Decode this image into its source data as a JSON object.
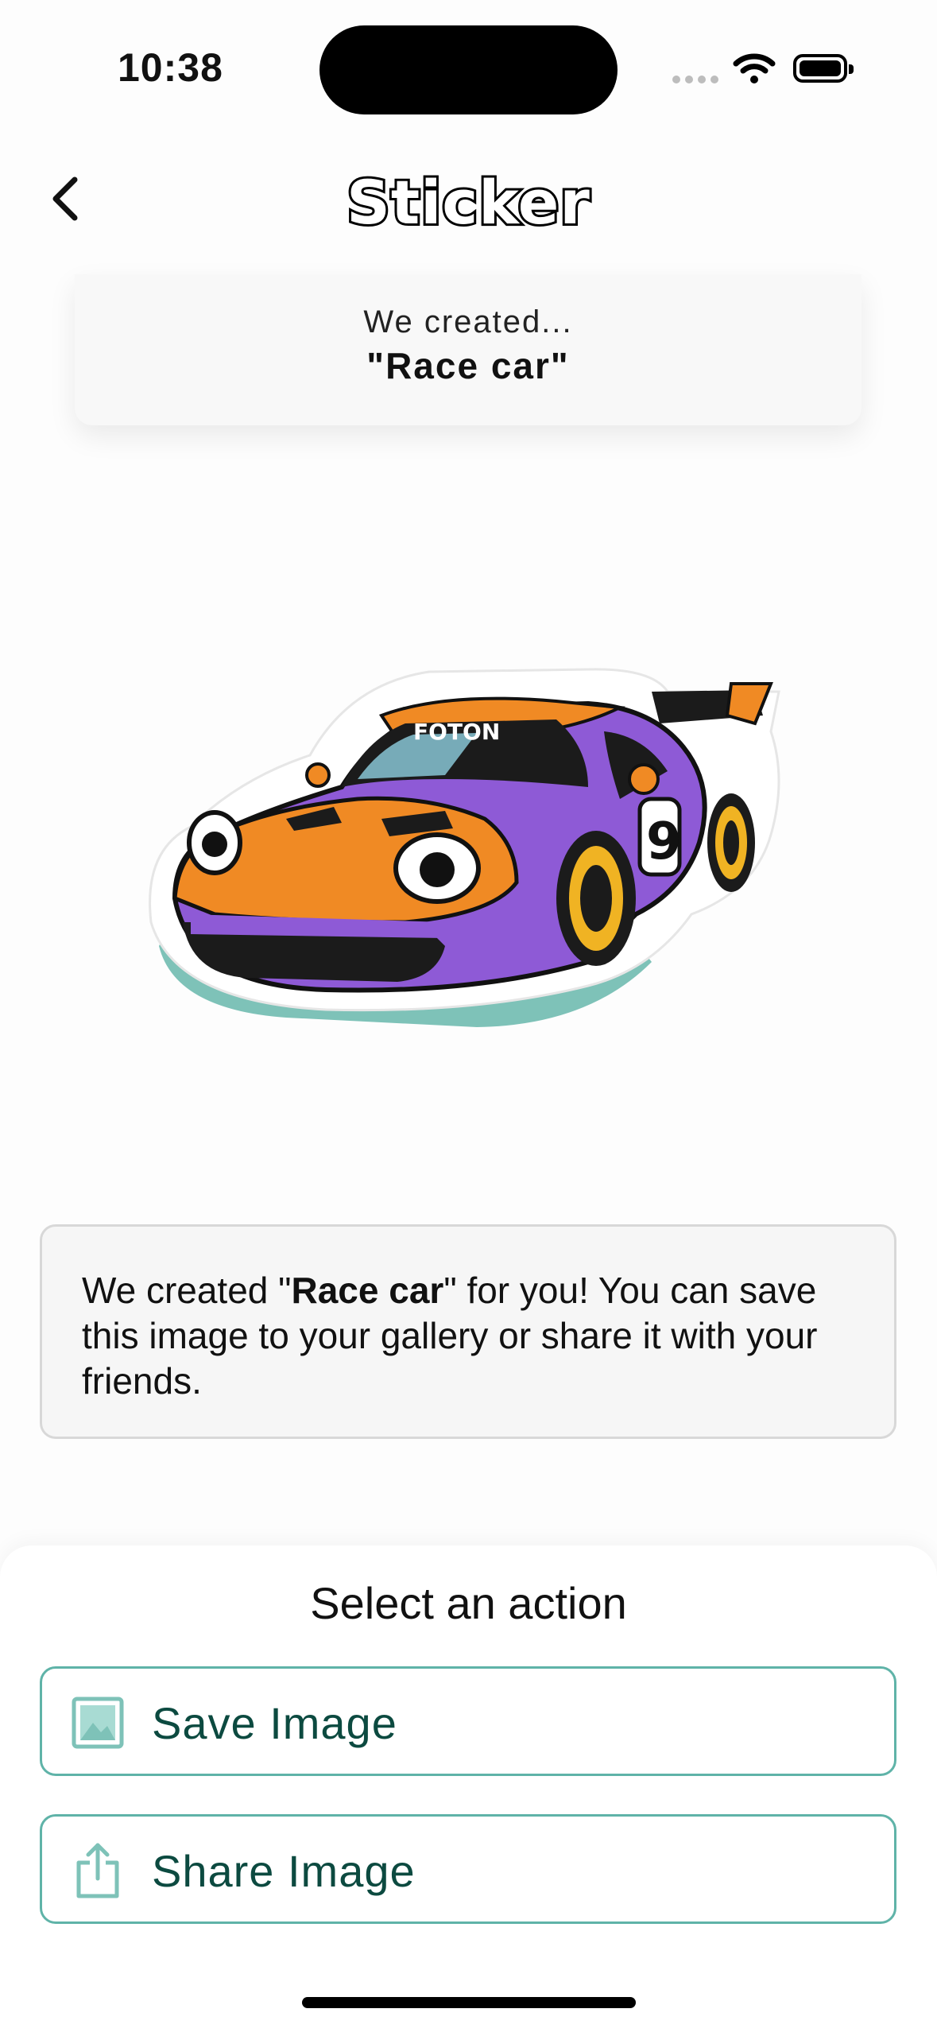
{
  "status": {
    "time": "10:38"
  },
  "header": {
    "title": "Sticker",
    "back_icon": "chevron-left-icon"
  },
  "created_card": {
    "prefix": "We created...",
    "name": "\"Race car\""
  },
  "sticker": {
    "subject": "Race car",
    "number": "9",
    "windshield_text": "FOTON",
    "colors": {
      "orange": "#f08a24",
      "purple": "#8e5ad6",
      "shadow": "#7ec2b8"
    }
  },
  "message": {
    "before": "We created \"",
    "bold": "Race car",
    "after": "\" for you! You can save this image to your gallery or share it with your friends."
  },
  "action_sheet": {
    "title": "Select an action",
    "save_label": "Save Image",
    "save_icon": "image-icon",
    "share_label": "Share Image",
    "share_icon": "share-icon"
  },
  "colors": {
    "accent": "#5fb3a8",
    "button_text": "#0c4a40"
  }
}
